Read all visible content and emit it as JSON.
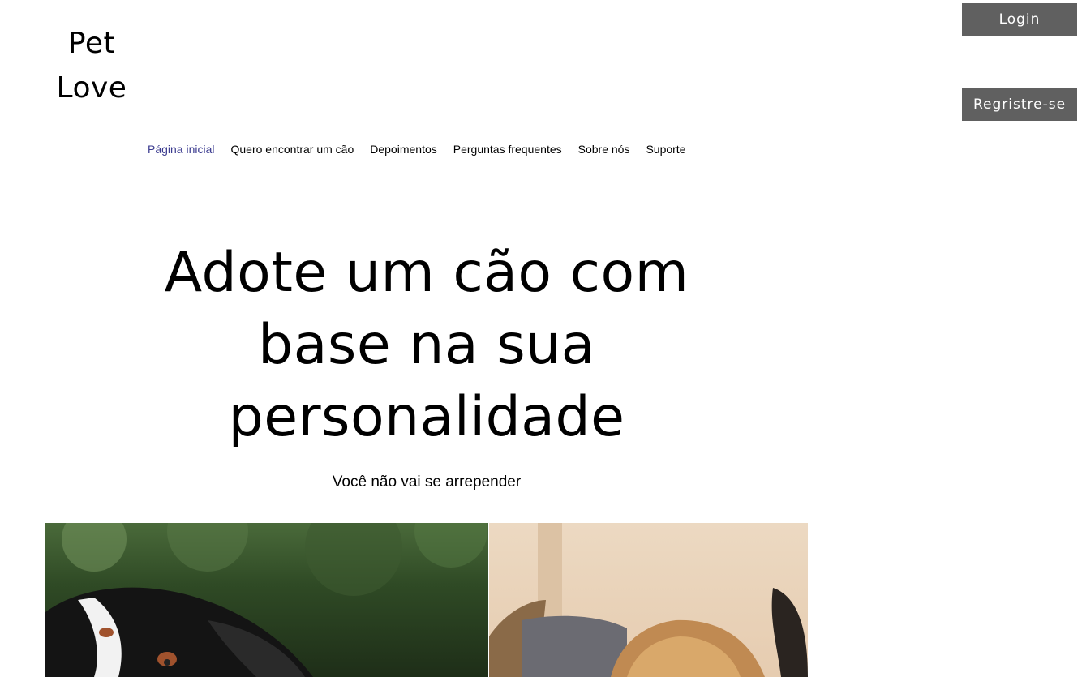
{
  "brand": {
    "line1": "Pet",
    "line2": "Love"
  },
  "auth": {
    "login_label": "Login",
    "register_label": "Regristre-se"
  },
  "nav": {
    "items": [
      {
        "label": "Página inicial"
      },
      {
        "label": "Quero encontrar um cão"
      },
      {
        "label": "Depoimentos"
      },
      {
        "label": "Perguntas frequentes"
      },
      {
        "label": "Sobre nós"
      },
      {
        "label": "Suporte"
      }
    ]
  },
  "hero": {
    "title_line1": "Adote um cão com",
    "title_line2": "base na sua",
    "title_line3": "personalidade",
    "subtitle": "Você não vai se arrepender"
  },
  "colors": {
    "button_bg": "#606060",
    "button_text": "#ffffff",
    "nav_active": "#3b3b8f"
  }
}
